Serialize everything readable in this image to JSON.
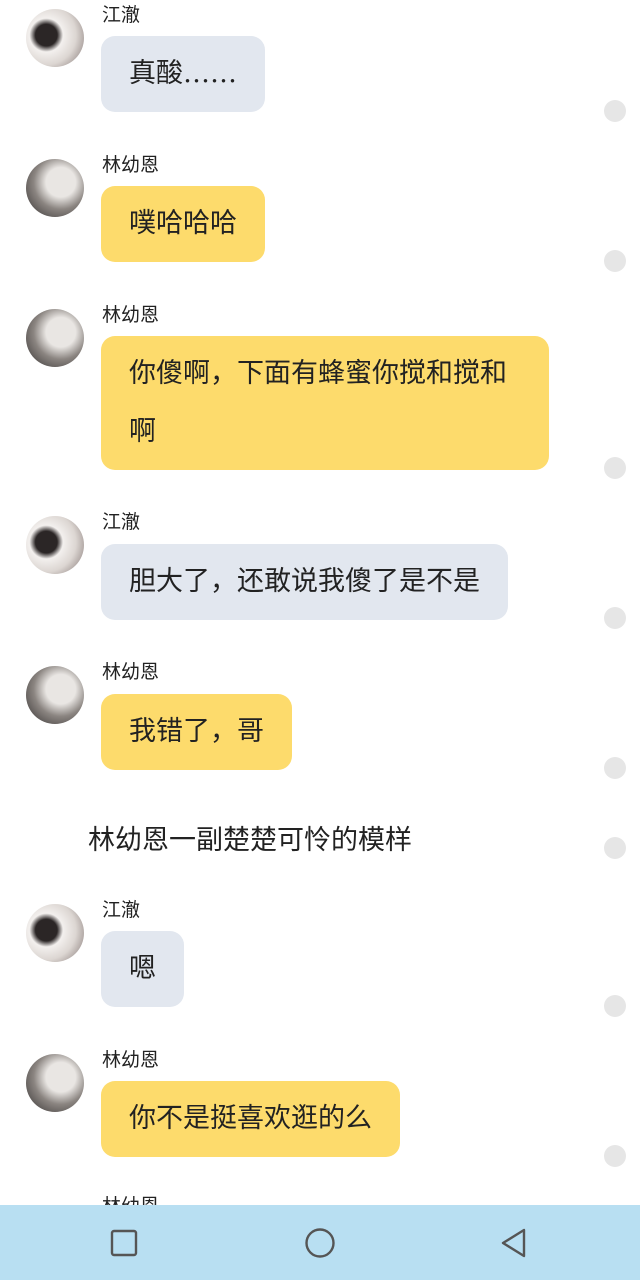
{
  "messages": [
    {
      "sender": "江澈",
      "text": "真酸……",
      "side": "in"
    },
    {
      "sender": "林幼恩",
      "text": "噗哈哈哈",
      "side": "out"
    },
    {
      "sender": "林幼恩",
      "text": "你傻啊，下面有蜂蜜你搅和搅和啊",
      "side": "out"
    },
    {
      "sender": "江澈",
      "text": "胆大了，还敢说我傻了是不是",
      "side": "in"
    },
    {
      "sender": "林幼恩",
      "text": "我错了，哥",
      "side": "out"
    },
    {
      "sender": "江澈",
      "text": "嗯",
      "side": "in"
    },
    {
      "sender": "林幼恩",
      "text": "你不是挺喜欢逛的么",
      "side": "out"
    }
  ],
  "narration": "林幼恩一副楚楚可怜的模样",
  "next_sender_partial": "林幼恩",
  "colors": {
    "incoming_bubble": "#e2e7ef",
    "outgoing_bubble": "#fddb6c",
    "nav_bar": "#b8dff2"
  },
  "nav": {
    "icons": [
      "recent-apps-square-icon",
      "home-circle-icon",
      "back-triangle-icon"
    ]
  }
}
